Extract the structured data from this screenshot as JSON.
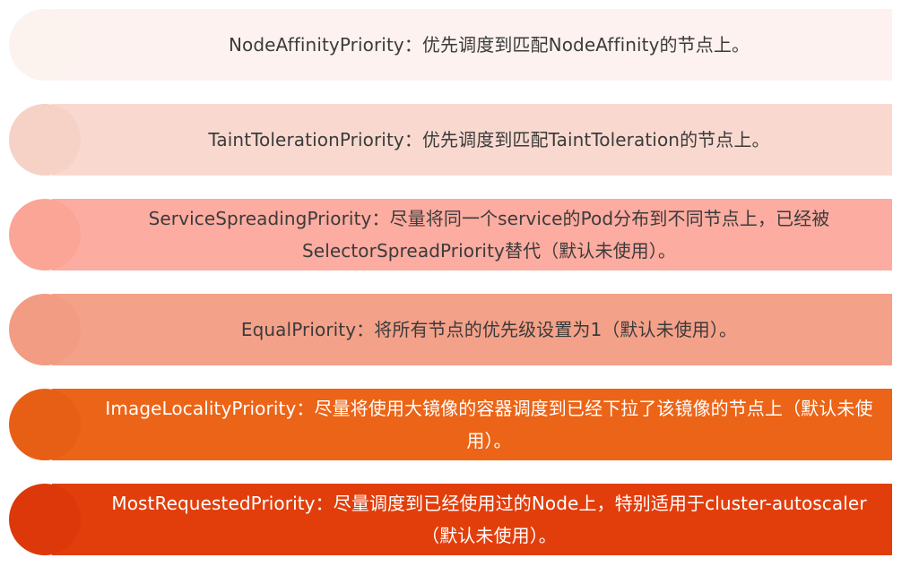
{
  "items": [
    {
      "text": "NodeAffinityPriority：优先调度到匹配NodeAffinity的节点上。",
      "bar_color": "#fdf2ef",
      "circle_color": "#fcf2ee",
      "text_color": "#3b3b3b"
    },
    {
      "text": "TaintTolerationPriority：优先调度到匹配TaintToleration的节点上。",
      "bar_color": "#f9d9cf",
      "circle_color": "#f6d1c5",
      "text_color": "#3b3b3b"
    },
    {
      "text": "ServiceSpreadingPriority：尽量将同一个service的Pod分布到不同节点上，已经被SelectorSpreadPriority替代（默认未使用）。",
      "bar_color": "#fcaca0",
      "circle_color": "#fba597",
      "text_color": "#3b3b3b"
    },
    {
      "text": "EqualPriority：将所有节点的优先级设置为1（默认未使用）。",
      "bar_color": "#f4a189",
      "circle_color": "#f29c83",
      "text_color": "#3b3b3b"
    },
    {
      "text": "ImageLocalityPriority：尽量将使用大镜像的容器调度到已经下拉了该镜像的节点上（默认未使用）。",
      "bar_color": "#ec6417",
      "circle_color": "#e75f14",
      "text_color": "#ffffff"
    },
    {
      "text": "MostRequestedPriority：尽量调度到已经使用过的Node上，特别适用于cluster-autoscaler（默认未使用）。",
      "bar_color": "#e23e0b",
      "circle_color": "#dc380a",
      "text_color": "#ffffff"
    }
  ]
}
